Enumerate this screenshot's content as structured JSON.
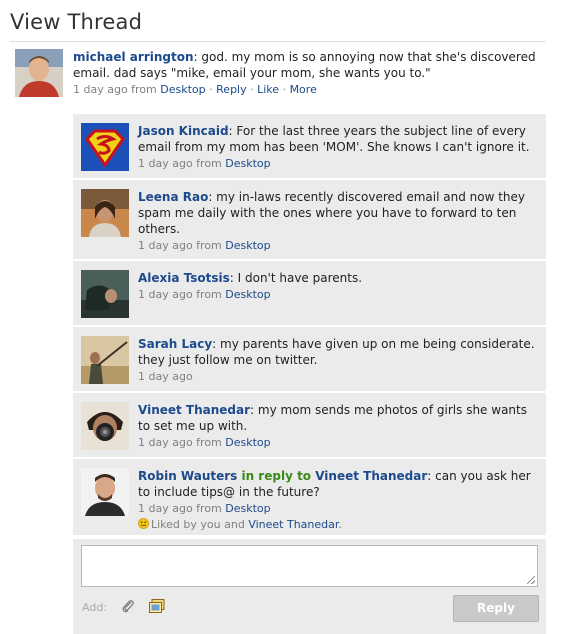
{
  "page": {
    "title": "View Thread"
  },
  "origin": {
    "author": "michael arrington",
    "text": ": god. my mom is so annoying now that she's discovered email. dad says \"mike, email your mom, she wants you to.\"",
    "time": "1 day ago from ",
    "source": "Desktop",
    "sep1": " · ",
    "reply": "Reply",
    "sep2": " · ",
    "like": "Like",
    "sep3": " · ",
    "more": "More"
  },
  "replies": [
    {
      "author": "Jason Kincaid",
      "text": ": For the last three years the subject line of every email from my mom has been 'MOM'. She knows I can't ignore it.",
      "time": "1 day ago from ",
      "source": "Desktop"
    },
    {
      "author": "Leena Rao",
      "text": ": my in-laws recently discovered email and now they spam me daily with the ones where you have to forward to ten others.",
      "time": "1 day ago from ",
      "source": "Desktop"
    },
    {
      "author": "Alexia Tsotsis",
      "text": ": I don't have parents.",
      "time": "1 day ago from ",
      "source": "Desktop"
    },
    {
      "author": "Sarah Lacy",
      "text": ": my parents have given up on me being considerate. they just follow me on twitter.",
      "time": "1 day ago",
      "source": ""
    },
    {
      "author": "Vineet Thanedar",
      "text": ": my mom sends me photos of girls she wants to set me up with.",
      "time": "1 day ago from ",
      "source": "Desktop"
    },
    {
      "author": "Robin Wauters",
      "reply_to_label": " in reply to ",
      "reply_to": "Vineet Thanedar",
      "text": ": can you ask her to include tips@ in the future?",
      "time": "1 day ago from ",
      "source": "Desktop",
      "liked_prefix": "Liked by you and ",
      "liked_by": "Vineet Thanedar",
      "liked_suffix": "."
    }
  ],
  "composer": {
    "add_label": "Add:",
    "reply_button": "Reply"
  },
  "colors": {
    "link": "#1c4a8c",
    "reply_bg": "#ebebeb",
    "in_reply_to": "#3a8a1a"
  },
  "icons": [
    "paperclip-icon",
    "photo-icon",
    "smiley-icon",
    "textarea-resize-icon"
  ]
}
